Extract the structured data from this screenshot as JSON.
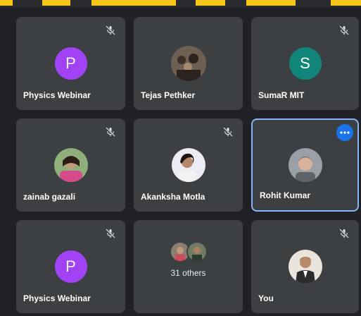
{
  "participants": [
    {
      "name": "Physics Webinar",
      "initial": "P",
      "avatar_color": "#a142f4",
      "muted": true
    },
    {
      "name": "Tejas Pethker",
      "muted": false
    },
    {
      "name": "SumaR MIT",
      "initial": "S",
      "avatar_color": "#12857a",
      "muted": true
    },
    {
      "name": "zainab gazali",
      "muted": true
    },
    {
      "name": "Akanksha Motla",
      "muted": true
    },
    {
      "name": "Rohit Kumar",
      "muted": false,
      "active_speaker": true
    },
    {
      "name": "Physics Webinar",
      "initial": "P",
      "avatar_color": "#a142f4",
      "muted": true
    },
    {
      "others_label": "31 others"
    },
    {
      "name": "You",
      "muted": true
    }
  ],
  "colors": {
    "background": "#202124",
    "tile": "#3c4043",
    "active_border": "#8ab4f8",
    "more_button": "#1a73e8"
  },
  "icons": {
    "muted": "mic-off-icon",
    "more": "more-options-icon"
  }
}
